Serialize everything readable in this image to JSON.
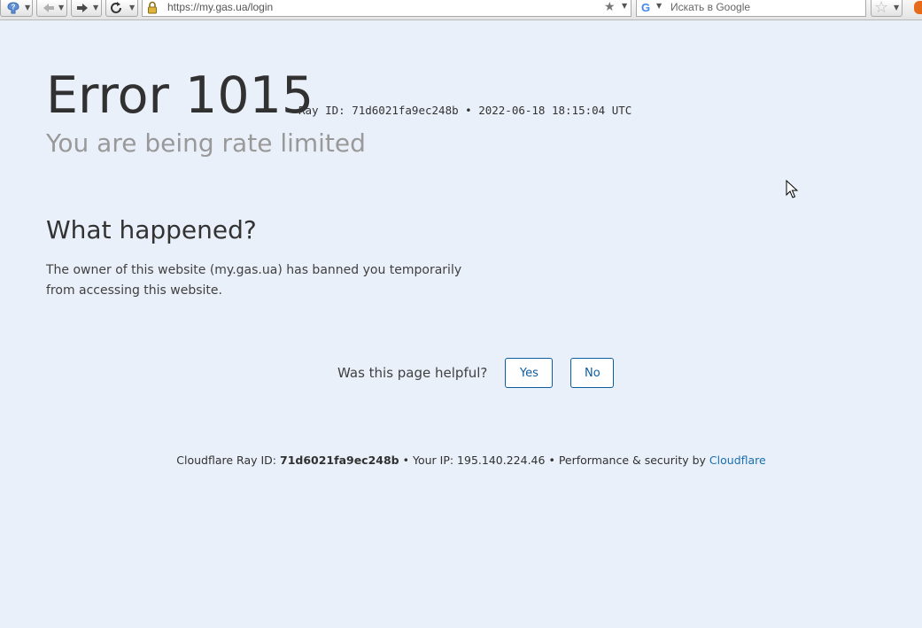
{
  "browser": {
    "url": "https://my.gas.ua/login",
    "search_placeholder": "Искать в Google",
    "search_engine_glyph": "G"
  },
  "page": {
    "error_code": "Error 1015",
    "ray_info": "Ray ID: 71d6021fa9ec248b • 2022-06-18 18:15:04 UTC",
    "subtitle": "You are being rate limited",
    "section_heading": "What happened?",
    "section_body": "The owner of this website (my.gas.ua) has banned you temporarily from accessing this website.",
    "feedback": {
      "question": "Was this page helpful?",
      "yes_label": "Yes",
      "no_label": "No"
    },
    "footer": {
      "ray_label": "Cloudflare Ray ID:",
      "ray_id": "71d6021fa9ec248b",
      "sep1": "•",
      "ip_text": "Your IP: 195.140.224.46",
      "sep2": "•",
      "perf_text": "Performance & security by",
      "cloudflare_link": "Cloudflare"
    }
  },
  "colors": {
    "page_background": "#eaf0fa",
    "button_accent": "#0d5d9e",
    "link": "#1a6fae",
    "subtitle_gray": "#999999"
  },
  "icons": [
    "help-icon",
    "back-arrow-icon",
    "forward-arrow-icon",
    "reload-icon",
    "lock-icon",
    "bookmark-star-icon",
    "google-icon",
    "bookmarks-menu-icon",
    "mouse-cursor-icon"
  ]
}
